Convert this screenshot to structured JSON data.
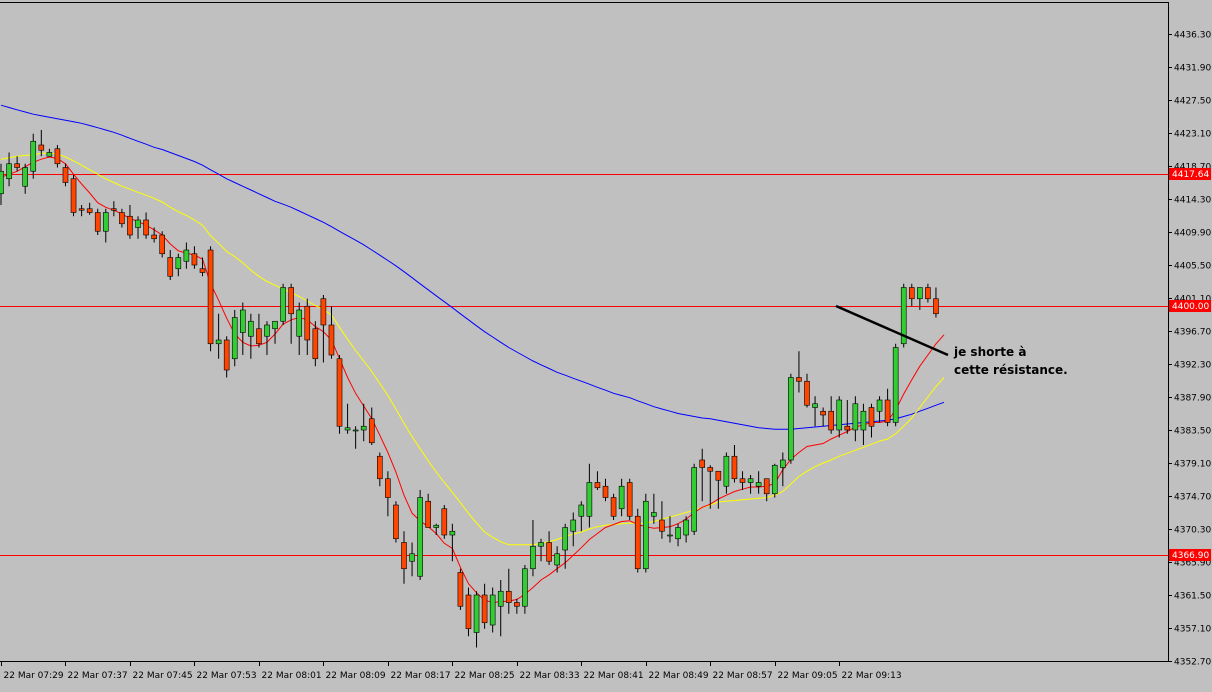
{
  "chart_data": {
    "type": "candlestick",
    "title": "",
    "xlabel": "",
    "ylabel": "",
    "ylim": [
      4352.7,
      4439.9
    ],
    "y_ticks": [
      "4436.30",
      "4431.90",
      "4427.50",
      "4423.10",
      "4418.70",
      "4414.30",
      "4409.90",
      "4405.50",
      "4401.10",
      "4396.70",
      "4392.30",
      "4387.90",
      "4383.50",
      "4379.10",
      "4374.70",
      "4370.30",
      "4365.90",
      "4361.50",
      "4357.10",
      "4352.70"
    ],
    "x_ticks": [
      "22 Mar 07:29",
      "22 Mar 07:37",
      "22 Mar 07:45",
      "22 Mar 07:53",
      "22 Mar 08:01",
      "22 Mar 08:09",
      "22 Mar 08:17",
      "22 Mar 08:25",
      "22 Mar 08:33",
      "22 Mar 08:41",
      "22 Mar 08:49",
      "22 Mar 08:57",
      "22 Mar 09:05",
      "22 Mar 09:13"
    ],
    "x_ticks_first_candle": [
      0,
      8,
      16,
      24,
      32,
      40,
      48,
      56,
      64,
      72,
      80,
      88,
      96,
      104
    ],
    "candles": [
      [
        4415.0,
        4419.0,
        4413.5,
        4418.0
      ],
      [
        4417.0,
        4420.5,
        4416.0,
        4419.0
      ],
      [
        4419.0,
        4420.0,
        4418.0,
        4418.5
      ],
      [
        4416.0,
        4419.0,
        4415.0,
        4418.5
      ],
      [
        4418.0,
        4423.0,
        4417.0,
        4422.0
      ],
      [
        4421.5,
        4423.5,
        4420.0,
        4420.8
      ],
      [
        4420.0,
        4421.0,
        4420.0,
        4420.5
      ],
      [
        4421.0,
        4421.5,
        4418.5,
        4419.0
      ],
      [
        4418.5,
        4419.0,
        4416.0,
        4416.5
      ],
      [
        4417.0,
        4417.5,
        4412.0,
        4412.5
      ],
      [
        4413.0,
        4413.5,
        4412.0,
        4412.8
      ],
      [
        4413.0,
        4413.8,
        4412.2,
        4412.5
      ],
      [
        4412.5,
        4413.0,
        4409.5,
        4410.0
      ],
      [
        4410.0,
        4413.0,
        4408.5,
        4412.5
      ],
      [
        4413.0,
        4414.0,
        4412.0,
        4412.8
      ],
      [
        4412.5,
        4413.0,
        4410.5,
        4411.0
      ],
      [
        4412.0,
        4413.5,
        4409.0,
        4409.5
      ],
      [
        4410.5,
        4412.0,
        4409.0,
        4411.5
      ],
      [
        4411.5,
        4412.5,
        4409.0,
        4409.5
      ],
      [
        4409.5,
        4410.5,
        4408.5,
        4409.0
      ],
      [
        4409.5,
        4410.0,
        4406.5,
        4407.0
      ],
      [
        4406.5,
        4407.5,
        4403.5,
        4404.0
      ],
      [
        4405.0,
        4407.0,
        4404.0,
        4406.5
      ],
      [
        4406.0,
        4408.5,
        4405.0,
        4407.5
      ],
      [
        4407.0,
        4408.0,
        4405.0,
        4405.5
      ],
      [
        4405.0,
        4406.5,
        4404.0,
        4404.5
      ],
      [
        4407.5,
        4408.0,
        4394.0,
        4395.0
      ],
      [
        4395.0,
        4399.0,
        4393.0,
        4395.5
      ],
      [
        4395.5,
        4396.0,
        4390.5,
        4391.5
      ],
      [
        4393.0,
        4399.5,
        4392.0,
        4398.5
      ],
      [
        4396.5,
        4400.5,
        4393.5,
        4399.5
      ],
      [
        4396.0,
        4399.0,
        4393.0,
        4398.0
      ],
      [
        4397.0,
        4399.0,
        4394.5,
        4395.0
      ],
      [
        4396.0,
        4398.0,
        4393.5,
        4397.5
      ],
      [
        4397.0,
        4398.0,
        4395.0,
        4398.0
      ],
      [
        4398.0,
        4403.0,
        4397.5,
        4402.5
      ],
      [
        4402.5,
        4403.0,
        4395.0,
        4399.0
      ],
      [
        4396.0,
        4400.5,
        4393.5,
        4399.5
      ],
      [
        4400.0,
        4401.0,
        4393.5,
        4395.5
      ],
      [
        4397.0,
        4398.0,
        4392.0,
        4393.0
      ],
      [
        4401.0,
        4401.5,
        4392.5,
        4397.5
      ],
      [
        4397.5,
        4400.0,
        4393.0,
        4393.5
      ],
      [
        4393.0,
        4393.5,
        4383.0,
        4384.0
      ],
      [
        4383.5,
        4387.0,
        4383.0,
        4383.8
      ],
      [
        4383.5,
        4384.0,
        4381.0,
        4383.5
      ],
      [
        4383.5,
        4387.0,
        4382.0,
        4384.0
      ],
      [
        4385.0,
        4386.5,
        4381.5,
        4381.8
      ],
      [
        4380.0,
        4380.5,
        4376.0,
        4377.0
      ],
      [
        4377.0,
        4378.0,
        4372.0,
        4374.5
      ],
      [
        4373.5,
        4374.0,
        4368.5,
        4369.0
      ],
      [
        4368.5,
        4370.0,
        4363.0,
        4365.0
      ],
      [
        4366.0,
        4368.5,
        4364.0,
        4367.0
      ],
      [
        4364.0,
        4375.5,
        4363.5,
        4374.5
      ],
      [
        4374.0,
        4375.0,
        4370.5,
        4370.5
      ],
      [
        4370.5,
        4371.0,
        4369.5,
        4370.8
      ],
      [
        4373.0,
        4373.5,
        4369.0,
        4369.5
      ],
      [
        4369.5,
        4371.0,
        4366.0,
        4370.0
      ],
      [
        4364.5,
        4365.0,
        4359.5,
        4360.0
      ],
      [
        4361.5,
        4362.5,
        4356.0,
        4357.0
      ],
      [
        4356.5,
        4362.0,
        4354.5,
        4361.5
      ],
      [
        4361.5,
        4363.0,
        4357.0,
        4357.8
      ],
      [
        4357.5,
        4362.5,
        4356.5,
        4361.5
      ],
      [
        4360.0,
        4363.5,
        4356.0,
        4362.0
      ],
      [
        4362.0,
        4365.0,
        4359.0,
        4360.5
      ],
      [
        4360.5,
        4361.0,
        4359.0,
        4360.0
      ],
      [
        4360.0,
        4365.5,
        4359.0,
        4365.0
      ],
      [
        4365.0,
        4371.5,
        4364.0,
        4368.0
      ],
      [
        4368.0,
        4369.0,
        4366.0,
        4368.5
      ],
      [
        4368.5,
        4370.0,
        4365.5,
        4366.0
      ],
      [
        4365.5,
        4368.0,
        4364.5,
        4367.0
      ],
      [
        4367.5,
        4371.0,
        4365.0,
        4370.5
      ],
      [
        4370.0,
        4372.5,
        4368.0,
        4371.5
      ],
      [
        4372.0,
        4374.0,
        4370.0,
        4373.5
      ],
      [
        4372.0,
        4379.0,
        4370.5,
        4376.5
      ],
      [
        4376.5,
        4378.0,
        4375.5,
        4375.8
      ],
      [
        4376.0,
        4377.0,
        4374.0,
        4374.5
      ],
      [
        4374.5,
        4375.0,
        4371.5,
        4372.0
      ],
      [
        4373.0,
        4377.0,
        4372.0,
        4376.0
      ],
      [
        4376.5,
        4377.0,
        4371.5,
        4372.0
      ],
      [
        4372.0,
        4373.0,
        4364.5,
        4365.0
      ],
      [
        4365.0,
        4375.0,
        4364.5,
        4374.0
      ],
      [
        4372.0,
        4375.0,
        4371.0,
        4372.5
      ],
      [
        4371.5,
        4374.0,
        4369.0,
        4370.0
      ],
      [
        4369.5,
        4372.0,
        4368.5,
        4369.5
      ],
      [
        4369.0,
        4371.0,
        4368.0,
        4370.5
      ],
      [
        4369.5,
        4372.0,
        4368.5,
        4371.5
      ],
      [
        4370.0,
        4379.0,
        4369.5,
        4378.5
      ],
      [
        4379.5,
        4381.0,
        4374.0,
        4378.5
      ],
      [
        4378.5,
        4378.8,
        4373.0,
        4378.0
      ],
      [
        4378.0,
        4377.0,
        4373.0,
        4376.8
      ],
      [
        4376.0,
        4380.5,
        4375.0,
        4380.0
      ],
      [
        4380.0,
        4381.5,
        4376.5,
        4377.0
      ],
      [
        4377.0,
        4378.0,
        4375.5,
        4376.5
      ],
      [
        4376.5,
        4377.5,
        4375.0,
        4377.0
      ],
      [
        4376.0,
        4378.0,
        4375.0,
        4376.5
      ],
      [
        4377.0,
        4376.5,
        4374.0,
        4375.0
      ],
      [
        4375.0,
        4379.0,
        4374.5,
        4378.8
      ],
      [
        4378.5,
        4380.5,
        4376.0,
        4379.5
      ],
      [
        4379.5,
        4391.0,
        4379.0,
        4390.5
      ],
      [
        4390.5,
        4394.0,
        4388.5,
        4390.0
      ],
      [
        4390.0,
        4391.0,
        4386.5,
        4386.8
      ],
      [
        4386.5,
        4388.0,
        4384.0,
        4387.0
      ],
      [
        4386.0,
        4386.5,
        4384.0,
        4385.5
      ],
      [
        4386.0,
        4388.0,
        4383.0,
        4383.5
      ],
      [
        4383.5,
        4388.0,
        4382.5,
        4387.5
      ],
      [
        4384.0,
        4387.5,
        4383.0,
        4383.5
      ],
      [
        4383.5,
        4388.0,
        4382.0,
        4387.0
      ],
      [
        4383.5,
        4387.0,
        4381.5,
        4386.0
      ],
      [
        4386.5,
        4387.0,
        4382.5,
        4384.0
      ],
      [
        4386.0,
        4388.0,
        4384.5,
        4387.5
      ],
      [
        4387.5,
        4389.0,
        4384.0,
        4384.5
      ],
      [
        4384.5,
        4395.0,
        4384.0,
        4394.5
      ],
      [
        4395.0,
        4403.0,
        4394.5,
        4402.5
      ],
      [
        4402.5,
        4403.0,
        4400.0,
        4401.0
      ],
      [
        4401.0,
        4402.5,
        4399.5,
        4402.5
      ],
      [
        4402.5,
        4403.0,
        4400.5,
        4401.0
      ],
      [
        4401.0,
        4402.5,
        4398.5,
        4399.0
      ]
    ],
    "series": [
      {
        "name": "",
        "color": "#0000ff",
        "values": [
          4426.8,
          4426.5,
          4426.2,
          4425.9,
          4425.6,
          4425.4,
          4425.2,
          4425.0,
          4424.8,
          4424.6,
          4424.4,
          4424.1,
          4423.8,
          4423.5,
          4423.2,
          4422.8,
          4422.4,
          4422.0,
          4421.6,
          4421.2,
          4420.9,
          4420.5,
          4420.1,
          4419.7,
          4419.3,
          4418.8,
          4418.2,
          4417.6,
          4417.0,
          4416.5,
          4416.0,
          4415.5,
          4415.0,
          4414.5,
          4414.0,
          4413.6,
          4413.2,
          4412.7,
          4412.2,
          4411.7,
          4411.2,
          4410.6,
          4410.0,
          4409.4,
          4408.8,
          4408.2,
          4407.5,
          4406.8,
          4406.1,
          4405.4,
          4404.6,
          4403.8,
          4403.0,
          4402.2,
          4401.4,
          4400.6,
          4399.8,
          4399.0,
          4398.2,
          4397.4,
          4396.6,
          4395.9,
          4395.2,
          4394.5,
          4393.9,
          4393.3,
          4392.7,
          4392.2,
          4391.7,
          4391.2,
          4390.8,
          4390.4,
          4390.0,
          4389.6,
          4389.2,
          4388.8,
          4388.4,
          4388.1,
          4387.8,
          4387.4,
          4387.0,
          4386.6,
          4386.3,
          4386.0,
          4385.7,
          4385.5,
          4385.3,
          4385.1,
          4385.0,
          4384.8,
          4384.6,
          4384.4,
          4384.2,
          4384.0,
          4383.8,
          4383.7,
          4383.6,
          4383.6,
          4383.6,
          4383.7,
          4383.8,
          4383.9,
          4384.0,
          4384.1,
          4384.2,
          4384.3,
          4384.4,
          4384.5,
          4384.6,
          4384.7,
          4384.8,
          4385.0,
          4385.3,
          4385.6,
          4386.0,
          4386.4,
          4386.8,
          4387.2
        ]
      },
      {
        "name": "",
        "color": "#ffff00",
        "values": [
          4419.6,
          4419.8,
          4420.0,
          4420.1,
          4420.2,
          4420.4,
          4420.4,
          4420.3,
          4419.9,
          4419.4,
          4418.8,
          4418.2,
          4417.6,
          4417.0,
          4416.5,
          4416.0,
          4415.6,
          4415.2,
          4414.8,
          4414.4,
          4413.9,
          4413.2,
          4412.6,
          4412.1,
          4411.5,
          4410.8,
          4409.4,
          4408.4,
          4407.3,
          4406.6,
          4405.8,
          4404.8,
          4404.0,
          4403.3,
          4402.8,
          4402.3,
          4401.8,
          4401.3,
          4400.7,
          4400.1,
          4399.6,
          4398.8,
          4397.2,
          4395.6,
          4394.1,
          4392.7,
          4391.3,
          4389.7,
          4388.1,
          4386.3,
          4384.4,
          4382.6,
          4381.0,
          4379.4,
          4377.9,
          4376.5,
          4375.2,
          4373.8,
          4372.4,
          4371.1,
          4369.9,
          4369.2,
          4368.6,
          4368.2,
          4368.2,
          4368.2,
          4368.2,
          4368.4,
          4368.6,
          4368.9,
          4369.3,
          4369.6,
          4369.9,
          4370.3,
          4370.6,
          4370.8,
          4370.9,
          4371.0,
          4371.1,
          4371.0,
          4371.1,
          4371.3,
          4371.6,
          4371.9,
          4372.2,
          4372.5,
          4372.8,
          4373.2,
          4373.5,
          4373.9,
          4374.0,
          4374.1,
          4374.2,
          4374.3,
          4374.4,
          4374.5,
          4374.8,
          4375.3,
          4376.3,
          4377.3,
          4378.0,
          4378.6,
          4379.1,
          4379.5,
          4380.0,
          4380.4,
          4380.8,
          4381.2,
          4381.6,
          4382.0,
          4382.3,
          4383.0,
          4384.0,
          4385.1,
          4386.5,
          4387.9,
          4389.3,
          4390.5
        ]
      },
      {
        "name": "",
        "color": "#ff0000",
        "values": [
          4417.2,
          4417.6,
          4418.0,
          4418.6,
          4419.2,
          4419.6,
          4419.9,
          4419.7,
          4419.0,
          4417.6,
          4416.3,
          4415.1,
          4413.8,
          4413.2,
          4412.8,
          4412.3,
          4411.7,
          4411.3,
          4410.8,
          4410.2,
          4409.5,
          4408.3,
          4407.4,
          4407.1,
          4406.8,
          4406.3,
          4403.0,
          4400.8,
          4398.4,
          4396.3,
          4395.2,
          4394.7,
          4394.8,
          4395.2,
          4396.3,
          4397.6,
          4398.2,
          4398.5,
          4398.2,
          4397.3,
          4396.6,
          4395.5,
          4393.0,
          4390.5,
          4388.4,
          4386.7,
          4385.0,
          4382.8,
          4380.5,
          4377.9,
          4374.8,
          4372.4,
          4371.4,
          4370.6,
          4369.7,
          4368.4,
          4367.7,
          4365.2,
          4363.0,
          4361.8,
          4360.8,
          4360.5,
          4360.6,
          4360.7,
          4360.9,
          4361.6,
          4362.5,
          4363.5,
          4364.2,
          4365.0,
          4365.8,
          4366.8,
          4367.8,
          4368.9,
          4369.7,
          4370.5,
          4370.9,
          4371.3,
          4371.4,
          4370.9,
          4370.6,
          4370.4,
          4370.5,
          4370.6,
          4371.0,
          4371.6,
          4372.5,
          4373.2,
          4373.6,
          4374.3,
          4374.8,
          4375.3,
          4375.6,
          4375.9,
          4375.9,
          4376.0,
          4376.4,
          4378.2,
          4379.6,
          4380.5,
          4381.3,
          4381.5,
          4381.7,
          4382.3,
          4382.8,
          4383.3,
          4383.9,
          4384.2,
          4384.5,
          4384.5,
          4384.7,
          4386.2,
          4388.3,
          4390.2,
          4392.0,
          4393.5,
          4395.0,
          4396.2
        ]
      }
    ],
    "hlines": [
      4417.64,
      4400.0,
      4366.9
    ],
    "hline_labels": [
      "4417.64",
      "4400.00",
      "4366.90"
    ],
    "annotation": "je shorte à cette résistance."
  }
}
